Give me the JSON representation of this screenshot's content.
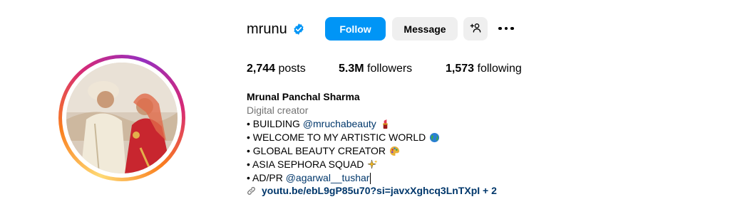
{
  "profile": {
    "username": "mrunu",
    "verified_icon": "verified-badge-icon",
    "follow_label": "Follow",
    "message_label": "Message",
    "add_user_icon": "add-person-icon",
    "more_icon": "more-options-icon"
  },
  "stats": {
    "posts_count": "2,744",
    "posts_label": "posts",
    "followers_count": "5.3M",
    "followers_label": "followers",
    "following_count": "1,573",
    "following_label": "following"
  },
  "bio": {
    "full_name": "Mrunal Panchal Sharma",
    "category": "Digital creator",
    "lines": [
      {
        "prefix": "• BUILDING ",
        "mention": "@mruchabeauty",
        "emoji": "lipstick-icon"
      },
      {
        "prefix": "• WELCOME TO MY ARTISTIC WORLD",
        "emoji": "globe-icon"
      },
      {
        "prefix": "• GLOBAL BEAUTY CREATOR",
        "emoji": "palette-icon"
      },
      {
        "prefix": "• ASIA SEPHORA SQUAD",
        "emoji": "sparkles-icon"
      },
      {
        "prefix": "• AD/PR ",
        "mention": "@agarwal__tushar"
      }
    ],
    "link_icon": "link-icon",
    "link_text": "youtu.be/ebL9gP85u70?si=javxXghcq3LnTXpI + 2"
  },
  "colors": {
    "primary_button": "#0095f6",
    "secondary_button": "#efefef",
    "link": "#00376b",
    "muted": "#737373",
    "verified": "#0095f6"
  }
}
